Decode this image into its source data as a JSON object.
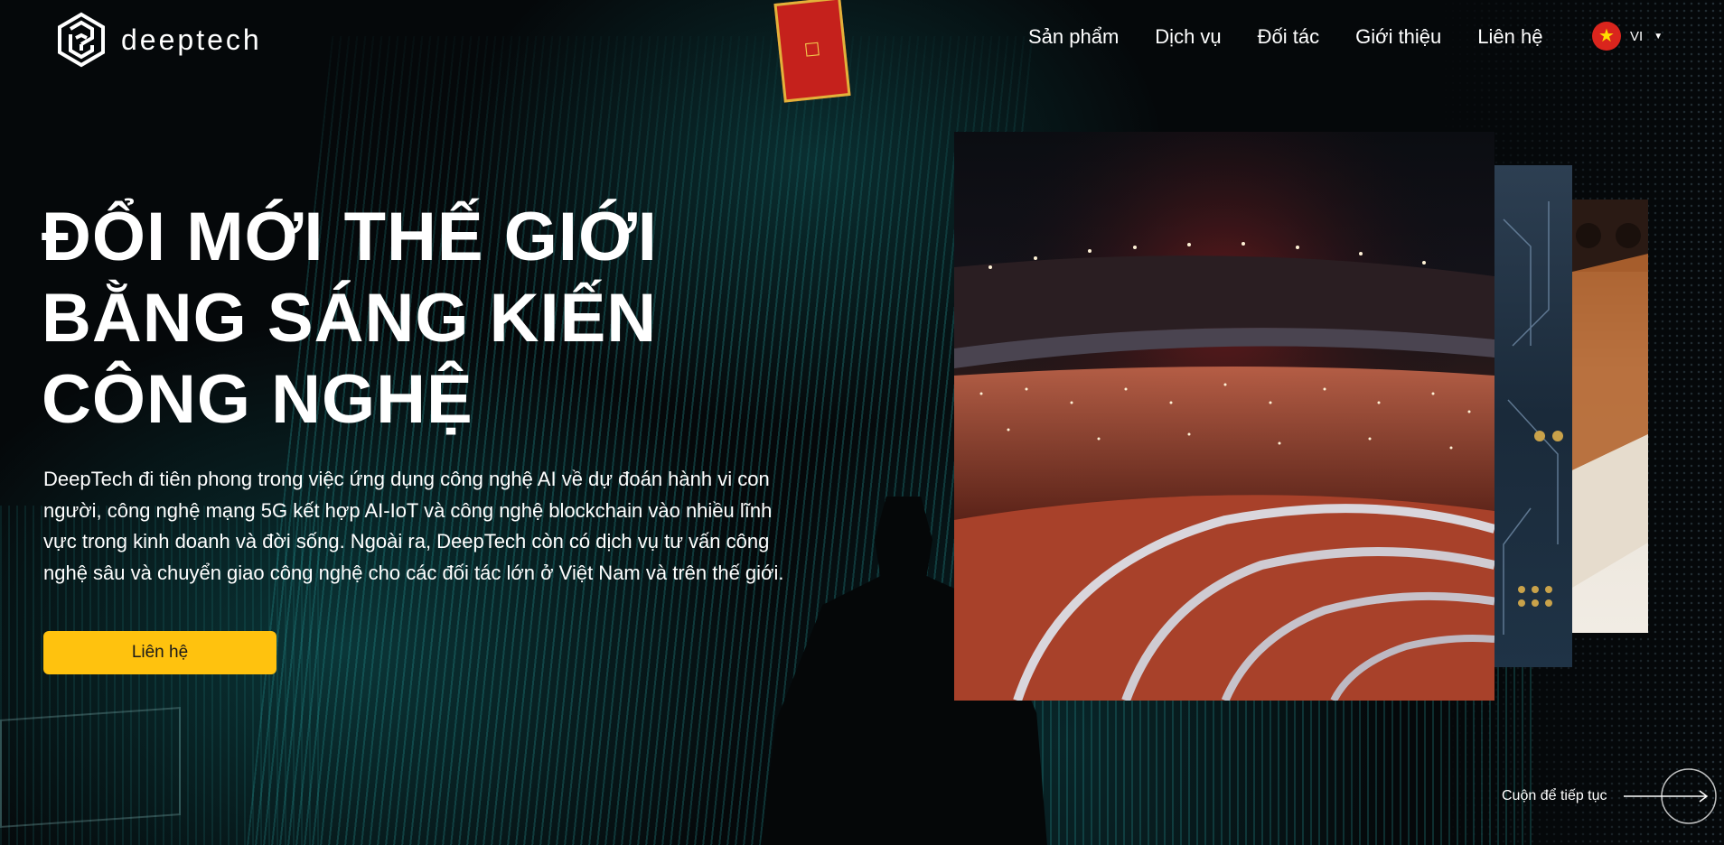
{
  "header": {
    "logo_text": "deeptech",
    "nav": [
      {
        "label": "Sản phẩm"
      },
      {
        "label": "Dịch vụ"
      },
      {
        "label": "Đối tác"
      },
      {
        "label": "Giới thiệu"
      },
      {
        "label": "Liên hệ"
      }
    ],
    "language": {
      "code": "VI",
      "flag_icon": "vietnam-flag-icon"
    }
  },
  "hero": {
    "title_lines": [
      "ĐỔI MỚI THẾ GIỚI",
      "BẰNG SÁNG KIẾN",
      "CÔNG NGHỆ"
    ],
    "description_lines": [
      "DeepTech đi tiên phong trong việc ứng dụng công nghệ AI về dự đoán hành vi con",
      "người, công nghệ mạng 5G kết hợp AI-IoT và công nghệ blockchain vào nhiều lĩnh",
      "vực trong kinh doanh và đời sống. Ngoài ra, DeepTech còn có dịch vụ tư vấn công",
      "nghệ sâu và chuyển giao công nghệ cho các đối tác lớn ở Việt Nam và trên thế giới."
    ],
    "cta_label": "Liên hệ"
  },
  "scroll_hint": {
    "label": "Cuộn để tiếp tục"
  },
  "colors": {
    "accent": "#ffc20e",
    "background": "#05080a",
    "teal": "#28a0a0"
  },
  "icons": {
    "logo": "deeptech-logo-icon",
    "scroll": "arrow-right-circle-icon"
  }
}
